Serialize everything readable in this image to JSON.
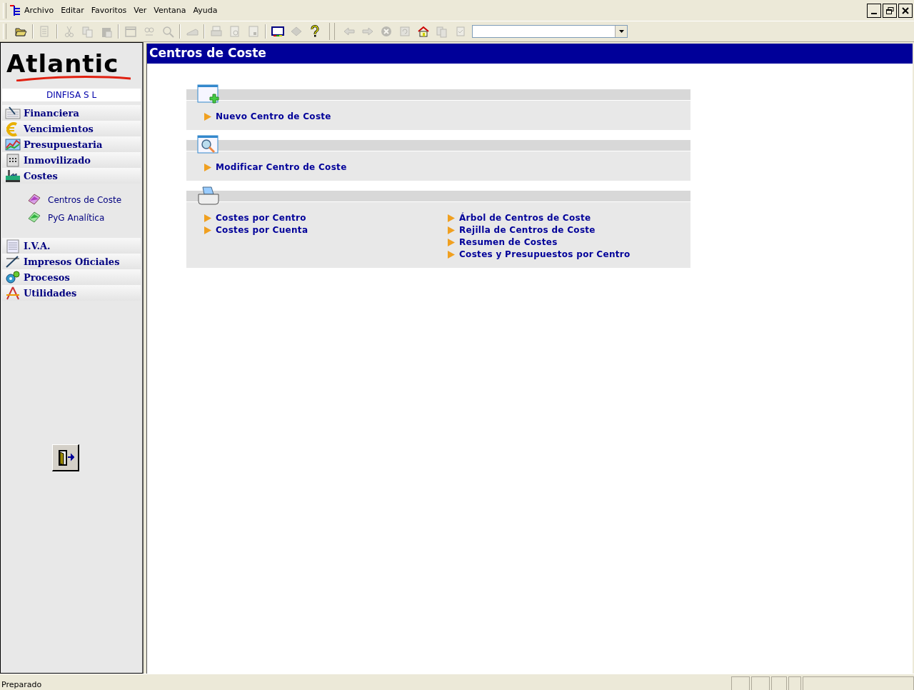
{
  "menu": [
    "Archivo",
    "Editar",
    "Favoritos",
    "Ver",
    "Ventana",
    "Ayuda"
  ],
  "toolbar": [
    {
      "kind": "open",
      "disabled": false
    },
    {
      "kind": "sep"
    },
    {
      "kind": "edit",
      "disabled": true
    },
    {
      "kind": "sep"
    },
    {
      "kind": "cut",
      "disabled": true
    },
    {
      "kind": "copy",
      "disabled": true
    },
    {
      "kind": "paste",
      "disabled": true
    },
    {
      "kind": "sep"
    },
    {
      "kind": "window",
      "disabled": true
    },
    {
      "kind": "find",
      "disabled": true
    },
    {
      "kind": "search",
      "disabled": true
    },
    {
      "kind": "sep"
    },
    {
      "kind": "scanner",
      "disabled": true
    },
    {
      "kind": "sep"
    },
    {
      "kind": "print",
      "disabled": true
    },
    {
      "kind": "preview",
      "disabled": true
    },
    {
      "kind": "page",
      "disabled": true
    },
    {
      "kind": "sep"
    },
    {
      "kind": "screen",
      "disabled": false
    },
    {
      "kind": "diamond",
      "disabled": true
    },
    {
      "kind": "help",
      "disabled": false
    },
    {
      "kind": "grip"
    },
    {
      "kind": "back",
      "disabled": true
    },
    {
      "kind": "forward",
      "disabled": true
    },
    {
      "kind": "stop",
      "disabled": true
    },
    {
      "kind": "refresh",
      "disabled": true
    },
    {
      "kind": "home",
      "disabled": false
    },
    {
      "kind": "docs",
      "disabled": true
    },
    {
      "kind": "check",
      "disabled": true
    }
  ],
  "sidebar": {
    "logo": "Atlantic",
    "company": "DINFISA  S L",
    "modules": [
      {
        "label": "Financiera"
      },
      {
        "label": "Vencimientos"
      },
      {
        "label": "Presupuestaria"
      },
      {
        "label": "Inmovilizado"
      },
      {
        "label": "Costes",
        "children": [
          {
            "label": "Centros de Coste"
          },
          {
            "label": "PyG Analítica"
          }
        ]
      },
      {
        "label": "I.V.A."
      },
      {
        "label": "Impresos Oficiales"
      },
      {
        "label": "Procesos"
      },
      {
        "label": "Utilidades"
      }
    ]
  },
  "page": {
    "title": "Centros de Coste",
    "sections": [
      {
        "kind": "new",
        "columns": [
          [
            "Nuevo Centro de Coste"
          ]
        ]
      },
      {
        "kind": "modify",
        "columns": [
          [
            "Modificar Centro de Coste"
          ]
        ]
      },
      {
        "kind": "print",
        "columns": [
          [
            "Costes por Centro",
            "Costes por Cuenta"
          ],
          [
            "Árbol de Centros de Coste",
            "Rejilla de Centros de Coste",
            "Resumen de Costes",
            "Costes y Presupuestos por Centro"
          ]
        ]
      }
    ]
  },
  "status_bar": {
    "text": "Preparado"
  }
}
